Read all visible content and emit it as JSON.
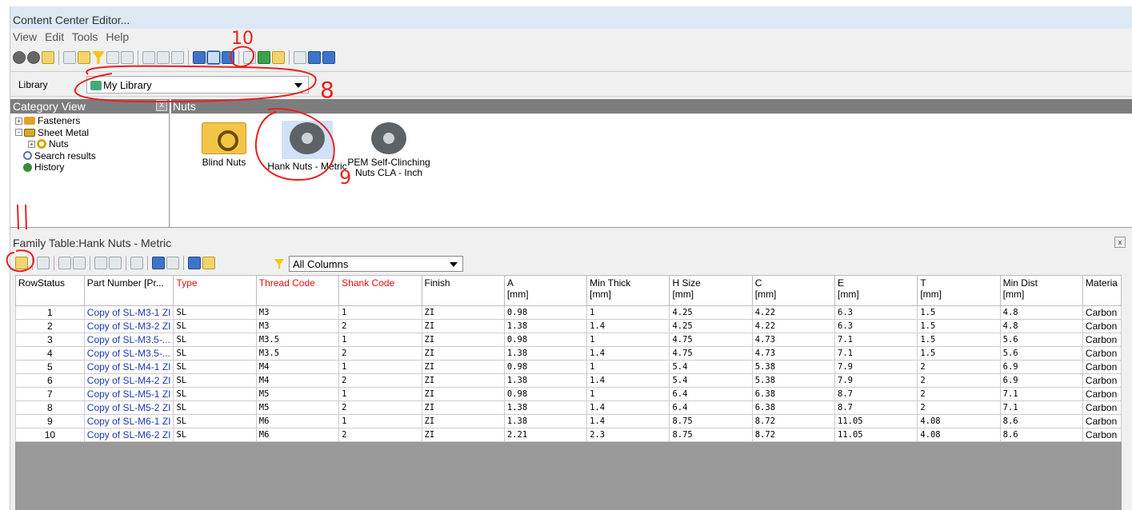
{
  "window": {
    "title": "Content Center Editor..."
  },
  "menu": [
    "View",
    "Edit",
    "Tools",
    "Help"
  ],
  "library": {
    "label": "Library",
    "selected": "My Library"
  },
  "category_view": {
    "title": "Category View",
    "close": "x",
    "items": [
      "Fasteners",
      "Sheet Metal",
      "Nuts",
      "Search results",
      "History"
    ]
  },
  "content": {
    "title": "Nuts",
    "items": [
      {
        "label": "Blind Nuts"
      },
      {
        "label": "Hank Nuts - Metric"
      },
      {
        "label": "PEM Self-Clinching Nuts CLA - Inch"
      }
    ]
  },
  "family_table": {
    "title": "Family Table:Hank Nuts - Metric",
    "close": "x",
    "column_filter": "All Columns",
    "columns": [
      {
        "label": "RowStatus",
        "red": false
      },
      {
        "label": "Part Number [Pr...",
        "red": false
      },
      {
        "label": "Type",
        "red": true
      },
      {
        "label": "Thread Code",
        "red": true
      },
      {
        "label": "Shank Code",
        "red": true
      },
      {
        "label": "Finish",
        "red": false
      },
      {
        "label": "A\n[mm]",
        "red": false
      },
      {
        "label": "Min Thick\n[mm]",
        "red": false
      },
      {
        "label": "H Size\n[mm]",
        "red": false
      },
      {
        "label": "C\n[mm]",
        "red": false
      },
      {
        "label": "E\n[mm]",
        "red": false
      },
      {
        "label": "T\n[mm]",
        "red": false
      },
      {
        "label": "Min Dist\n[mm]",
        "red": false
      },
      {
        "label": "Materia",
        "red": false
      }
    ],
    "rows": [
      [
        "1",
        "Copy of SL-M3-1 ZI",
        "SL",
        "M3",
        "1",
        "ZI",
        "0.98",
        "1",
        "4.25",
        "4.22",
        "6.3",
        "1.5",
        "4.8",
        "Carbon"
      ],
      [
        "2",
        "Copy of SL-M3-2 ZI",
        "SL",
        "M3",
        "2",
        "ZI",
        "1.38",
        "1.4",
        "4.25",
        "4.22",
        "6.3",
        "1.5",
        "4.8",
        "Carbon"
      ],
      [
        "3",
        "Copy of SL-M3.5-...",
        "SL",
        "M3.5",
        "1",
        "ZI",
        "0.98",
        "1",
        "4.75",
        "4.73",
        "7.1",
        "1.5",
        "5.6",
        "Carbon"
      ],
      [
        "4",
        "Copy of SL-M3.5-...",
        "SL",
        "M3.5",
        "2",
        "ZI",
        "1.38",
        "1.4",
        "4.75",
        "4.73",
        "7.1",
        "1.5",
        "5.6",
        "Carbon"
      ],
      [
        "5",
        "Copy of SL-M4-1 ZI",
        "SL",
        "M4",
        "1",
        "ZI",
        "0.98",
        "1",
        "5.4",
        "5.38",
        "7.9",
        "2",
        "6.9",
        "Carbon"
      ],
      [
        "6",
        "Copy of SL-M4-2 ZI",
        "SL",
        "M4",
        "2",
        "ZI",
        "1.38",
        "1.4",
        "5.4",
        "5.38",
        "7.9",
        "2",
        "6.9",
        "Carbon"
      ],
      [
        "7",
        "Copy of SL-M5-1 ZI",
        "SL",
        "M5",
        "1",
        "ZI",
        "0.98",
        "1",
        "6.4",
        "6.38",
        "8.7",
        "2",
        "7.1",
        "Carbon"
      ],
      [
        "8",
        "Copy of SL-M5-2 ZI",
        "SL",
        "M5",
        "2",
        "ZI",
        "1.38",
        "1.4",
        "6.4",
        "6.38",
        "8.7",
        "2",
        "7.1",
        "Carbon"
      ],
      [
        "9",
        "Copy of SL-M6-1 ZI",
        "SL",
        "M6",
        "1",
        "ZI",
        "1.38",
        "1.4",
        "8.75",
        "8.72",
        "11.05",
        "4.08",
        "8.6",
        "Carbon"
      ],
      [
        "10",
        "Copy of SL-M6-2 ZI",
        "SL",
        "M6",
        "2",
        "ZI",
        "2.21",
        "2.3",
        "8.75",
        "8.72",
        "11.05",
        "4.08",
        "8.6",
        "Carbon"
      ]
    ]
  },
  "annotations": [
    "10",
    "8",
    "9",
    "11"
  ],
  "colors": {
    "annotation": "#e8201f",
    "header_bar": "#7d7d7d",
    "link_blue": "#1a3bb3",
    "required_red": "#d11111"
  }
}
